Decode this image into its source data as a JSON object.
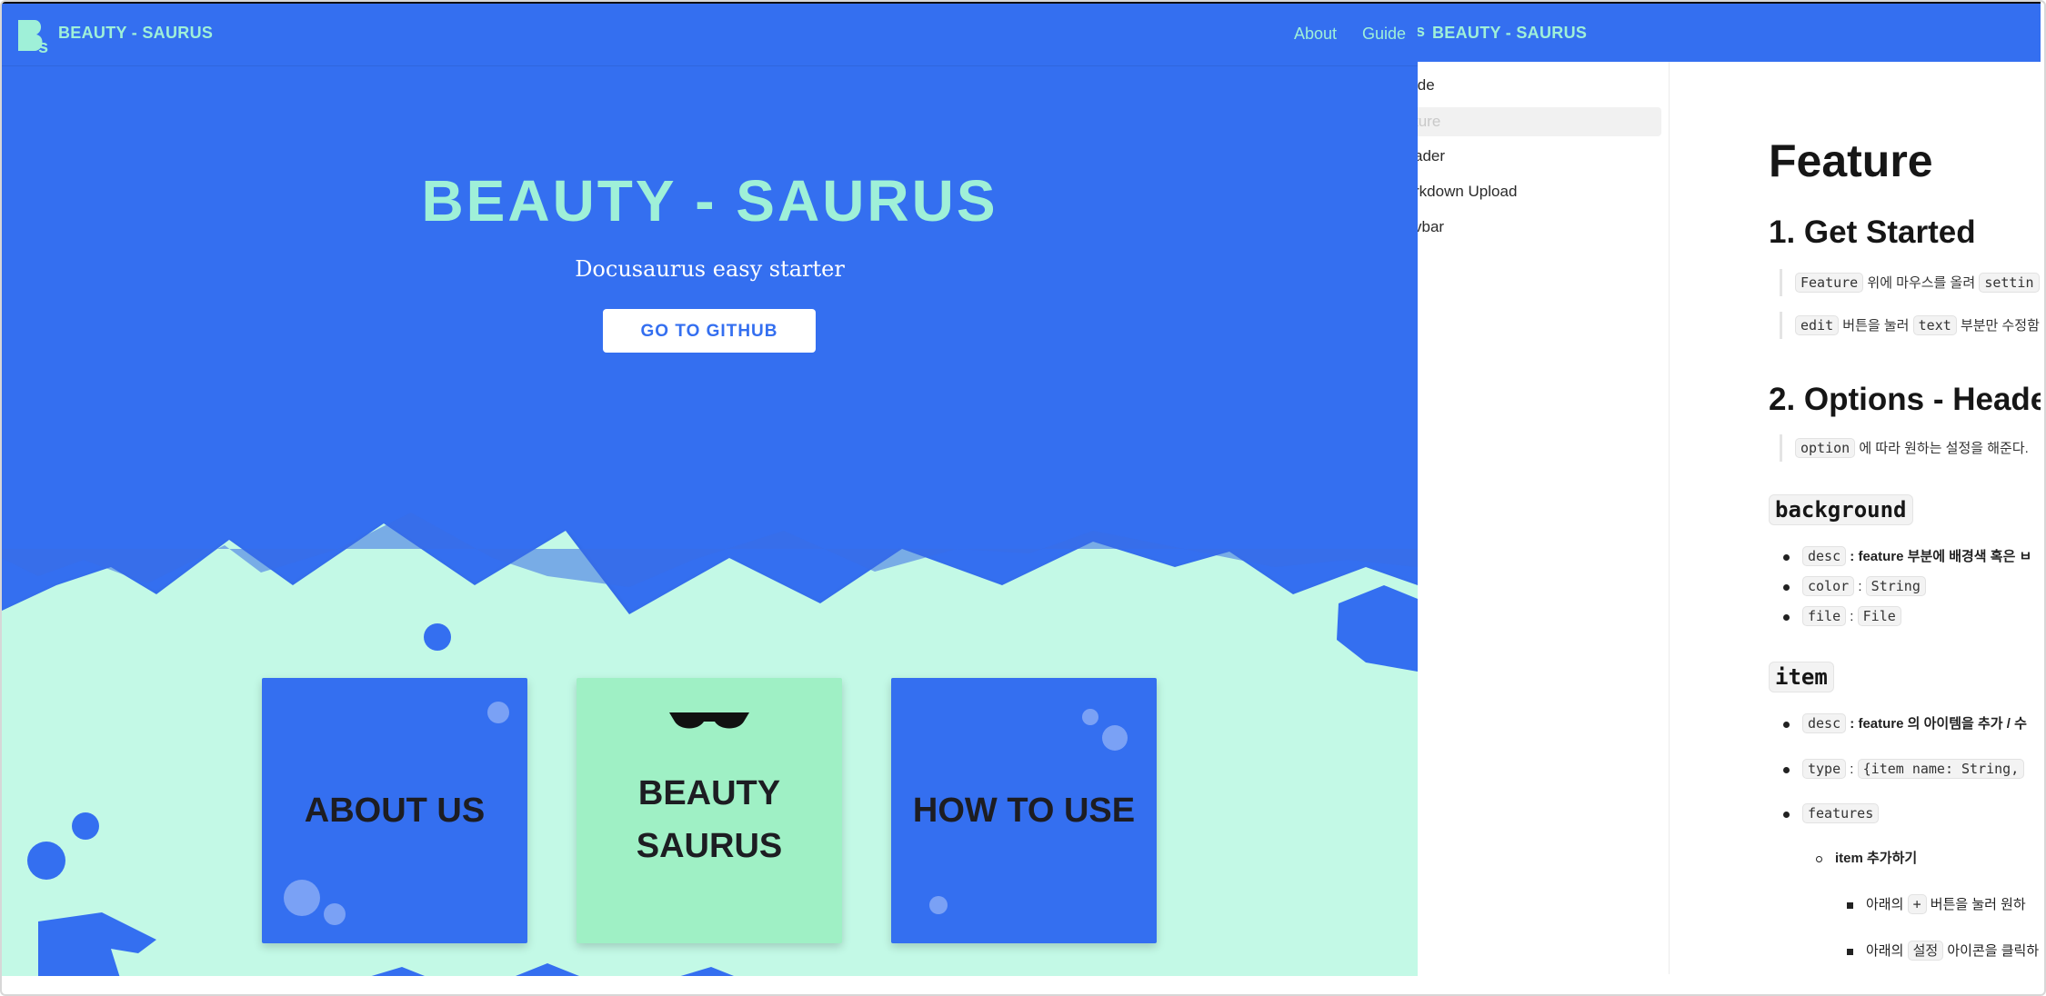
{
  "site": {
    "brand": "BEAUTY - SAURUS",
    "nav_links": [
      "About",
      "Guide"
    ],
    "hero": {
      "title": "BEAUTY - SAURUS",
      "subtitle": "Docusaurus easy starter",
      "button": "GO TO GITHUB"
    },
    "cards": [
      "ABOUT US",
      "BEAUTY SAURUS",
      "HOW TO USE"
    ],
    "colors": {
      "primary": "#346ff0",
      "mint": "#9ff0d8",
      "mint_bg": "#c3f9e6",
      "card_green": "#9ff0c5"
    }
  },
  "docs": {
    "brand": "BEAUTY - SAURUS",
    "sidebar": [
      "ide",
      "ture",
      "ader",
      "rkdown Upload",
      "vbar"
    ],
    "title": "Feature",
    "sections": {
      "get_started": "1. Get Started",
      "q1_code": "Feature",
      "q1_text": "위에 마우스를 올려",
      "q1_code2": "settin",
      "q2_code": "edit",
      "q2_text": "버튼을 눌러",
      "q2_code2": "text",
      "q2_text2": "부분만 수정함",
      "options_header": "2. Options - Heade",
      "q3_code": "option",
      "q3_text": "에 따라 원하는 설정을 해준다.",
      "background": "background",
      "bg_items": [
        {
          "code": "desc",
          "text": ": feature 부분에 배경색 혹은 ㅂ"
        },
        {
          "code": "color",
          "code2": "String"
        },
        {
          "code": "file",
          "code2": "File"
        }
      ],
      "item": "item",
      "item_list": {
        "desc_code": "desc",
        "desc_text": ": feature 의 아이템을 추가 / 수",
        "type_code": "type",
        "type_value": "{item name: String,",
        "features_code": "features",
        "sub": "item 추가하기",
        "subsub1_pre": "아래의",
        "subsub1_code": "+",
        "subsub1_post": "버튼을 눌러 원하",
        "subsub2_pre": "아래의",
        "subsub2_code": "설정",
        "subsub2_post": "아이콘을 클릭하"
      }
    }
  }
}
